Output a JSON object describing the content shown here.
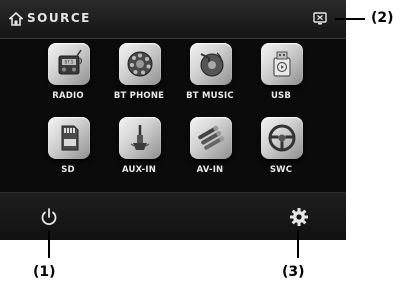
{
  "header": {
    "title": "SOURCE",
    "home_icon": "home-icon",
    "screen_icon": "screen-toggle-icon"
  },
  "sources": [
    {
      "label": "RADIO",
      "icon": "radio-icon"
    },
    {
      "label": "BT PHONE",
      "icon": "bt-phone-icon"
    },
    {
      "label": "BT MUSIC",
      "icon": "bt-music-icon"
    },
    {
      "label": "USB",
      "icon": "usb-icon"
    },
    {
      "label": "SD",
      "icon": "sd-card-icon"
    },
    {
      "label": "AUX-IN",
      "icon": "aux-in-icon"
    },
    {
      "label": "AV-IN",
      "icon": "av-in-icon"
    },
    {
      "label": "SWC",
      "icon": "steering-wheel-icon"
    }
  ],
  "footer": {
    "power_icon": "power-icon",
    "settings_icon": "gear-icon"
  },
  "callouts": {
    "power": "(1)",
    "screen": "(2)",
    "settings": "(3)"
  }
}
